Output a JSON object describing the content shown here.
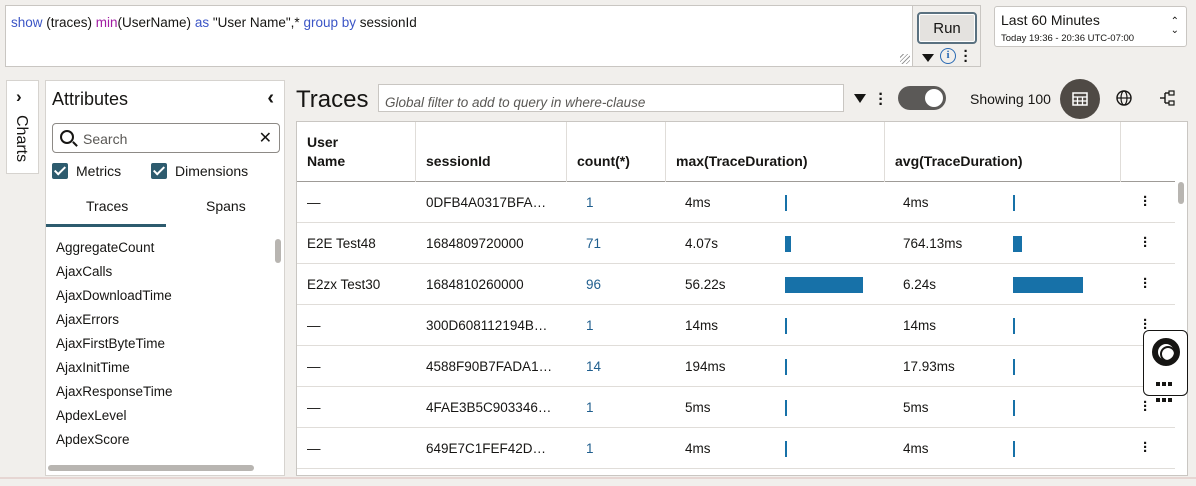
{
  "query": {
    "tokens": [
      {
        "text": "show",
        "kind": "kw"
      },
      {
        "text": " (traces) ",
        "kind": "plain"
      },
      {
        "text": "min",
        "kind": "fn"
      },
      {
        "text": "(UserName) ",
        "kind": "plain"
      },
      {
        "text": "as",
        "kind": "kw"
      },
      {
        "text": " \"User Name\",* ",
        "kind": "plain"
      },
      {
        "text": "group by",
        "kind": "kw"
      },
      {
        "text": " sessionId",
        "kind": "plain"
      }
    ],
    "run_label": "Run"
  },
  "time_range": {
    "label": "Last 60 Minutes",
    "detail": "Today 19:36 - 20:36 UTC-07:00"
  },
  "charts_tab": {
    "label": "Charts"
  },
  "attributes": {
    "title": "Attributes",
    "search_placeholder": "Search",
    "checkboxes": [
      {
        "label": "Metrics",
        "checked": true
      },
      {
        "label": "Dimensions",
        "checked": true
      }
    ],
    "tabs": [
      "Traces",
      "Spans"
    ],
    "active_tab": "Traces",
    "items": [
      "AggregateCount",
      "AjaxCalls",
      "AjaxDownloadTime",
      "AjaxErrors",
      "AjaxFirstByteTime",
      "AjaxInitTime",
      "AjaxResponseTime",
      "ApdexLevel",
      "ApdexScore"
    ]
  },
  "traces": {
    "title": "Traces",
    "filter_placeholder": "Global filter to add to query in where-clause",
    "showing": "Showing 100",
    "columns": [
      "User Name",
      "sessionId",
      "count(*)",
      "max(TraceDuration)",
      "avg(TraceDuration)"
    ],
    "rows": [
      {
        "user": "—",
        "session": "0DFB4A0317BFA…",
        "count": "1",
        "max": "4ms",
        "max_ms": 4,
        "avg": "4ms",
        "avg_ms": 4
      },
      {
        "user": "E2E Test48",
        "session": "1684809720000",
        "count": "71",
        "max": "4.07s",
        "max_ms": 4070,
        "avg": "764.13ms",
        "avg_ms": 764.13
      },
      {
        "user": "E2zx Test30",
        "session": "1684810260000",
        "count": "96",
        "max": "56.22s",
        "max_ms": 56220,
        "avg": "6.24s",
        "avg_ms": 6240
      },
      {
        "user": "—",
        "session": "300D608112194B…",
        "count": "1",
        "max": "14ms",
        "max_ms": 14,
        "avg": "14ms",
        "avg_ms": 14
      },
      {
        "user": "—",
        "session": "4588F90B7FADA1…",
        "count": "14",
        "max": "194ms",
        "max_ms": 194,
        "avg": "17.93ms",
        "avg_ms": 17.93
      },
      {
        "user": "—",
        "session": "4FAE3B5C903346…",
        "count": "1",
        "max": "5ms",
        "max_ms": 5,
        "avg": "5ms",
        "avg_ms": 5
      },
      {
        "user": "—",
        "session": "649E7C1FEF42D…",
        "count": "1",
        "max": "4ms",
        "max_ms": 4,
        "avg": "4ms",
        "avg_ms": 4
      }
    ]
  },
  "icons": {
    "table_view": "table-icon",
    "globe": "globe-icon",
    "tree": "tree-icon",
    "help": "help-lifebuoy-icon"
  },
  "colors": {
    "accent": "#1771a8",
    "link": "#1f5e8e",
    "keyword": "#3b55c6",
    "function": "#a11da3"
  }
}
